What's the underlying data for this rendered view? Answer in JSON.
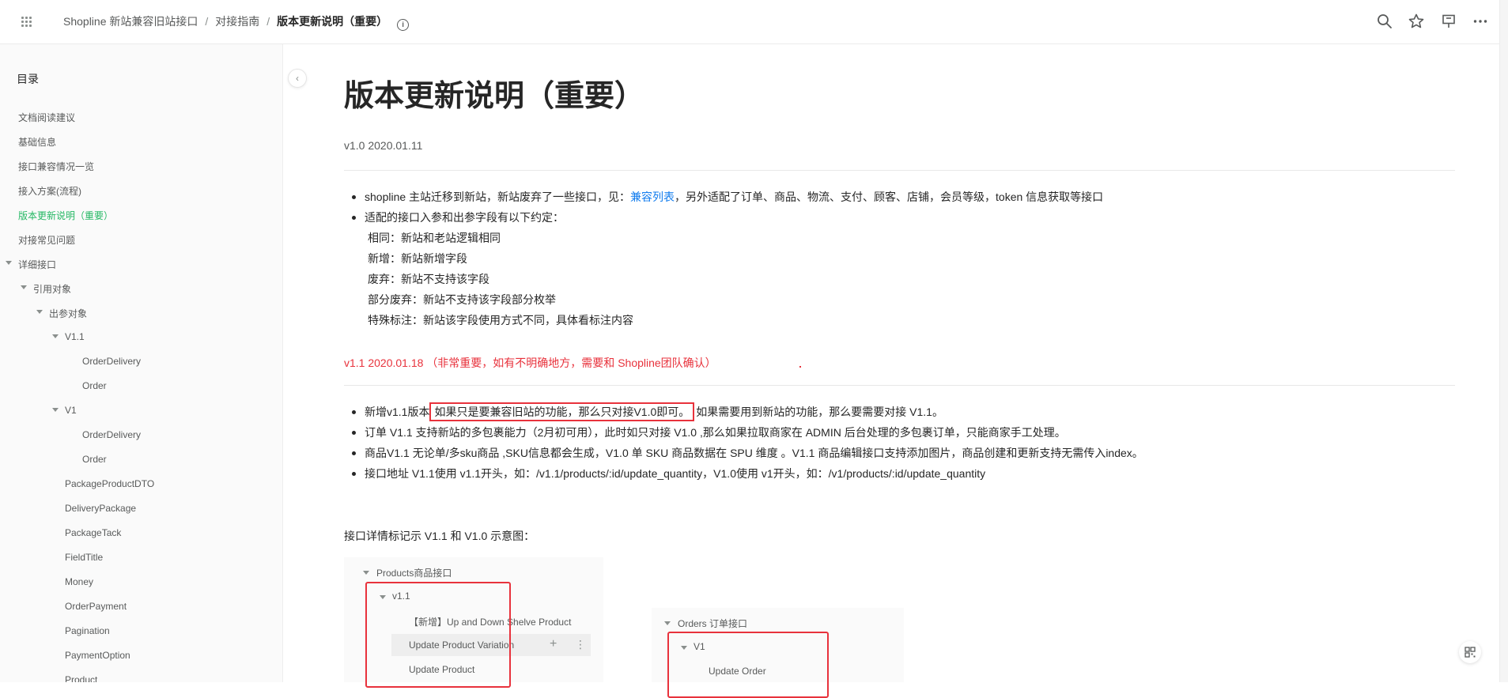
{
  "breadcrumb": {
    "items": [
      "Shopline 新站兼容旧站接口",
      "对接指南",
      "版本更新说明（重要）"
    ]
  },
  "toc": {
    "title": "目录",
    "items": [
      {
        "label": "文档阅读建议",
        "level": 0
      },
      {
        "label": "基础信息",
        "level": 0
      },
      {
        "label": "接口兼容情况一览",
        "level": 0
      },
      {
        "label": "接入方案(流程)",
        "level": 0
      },
      {
        "label": "版本更新说明（重要）",
        "level": 0,
        "active": true
      },
      {
        "label": "对接常见问题",
        "level": 0
      },
      {
        "label": "详细接口",
        "level": 0,
        "expanded": true
      },
      {
        "label": "引用对象",
        "level": 1,
        "expanded": true
      },
      {
        "label": "出参对象",
        "level": 2,
        "expanded": true
      },
      {
        "label": "V1.1",
        "level": 3,
        "expanded": true
      },
      {
        "label": "OrderDelivery",
        "level": 4
      },
      {
        "label": "Order",
        "level": 4
      },
      {
        "label": "V1",
        "level": 3,
        "expanded": true
      },
      {
        "label": "OrderDelivery",
        "level": 4
      },
      {
        "label": "Order",
        "level": 4
      },
      {
        "label": "PackageProductDTO",
        "level": 3
      },
      {
        "label": "DeliveryPackage",
        "level": 3
      },
      {
        "label": "PackageTack",
        "level": 3
      },
      {
        "label": "FieldTitle",
        "level": 3
      },
      {
        "label": "Money",
        "level": 3
      },
      {
        "label": "OrderPayment",
        "level": 3
      },
      {
        "label": "Pagination",
        "level": 3
      },
      {
        "label": "PaymentOption",
        "level": 3
      },
      {
        "label": "Product",
        "level": 3
      }
    ]
  },
  "doc": {
    "title": "版本更新说明（重要）",
    "v10": {
      "heading": "v1.0 2020.01.11",
      "bullet1_pre": "shopline 主站迁移到新站，新站废弃了一些接口，见：",
      "bullet1_link": "兼容列表",
      "bullet1_post": "，另外适配了订单、商品、物流、支付、顾客、店铺，会员等级，token 信息获取等接口",
      "bullet2": "适配的接口入参和出参字段有以下约定：",
      "rules": [
        "相同：新站和老站逻辑相同",
        "新增：新站新增字段",
        "废弃：新站不支持该字段",
        "部分废弃：新站不支持该字段部分枚举",
        "特殊标注：新站该字段使用方式不同，具体看标注内容"
      ]
    },
    "v11": {
      "heading": "v1.1 2020.01.18 （非常重要，如有不明确地方，需要和 Shopline团队确认）",
      "b1_pre": "新增v1.1版本",
      "b1_box": "如果只是要兼容旧站的功能，那么只对接V1.0即可。",
      "b1_post": "如果需要用到新站的功能，那么要需要对接 V1.1。",
      "b2": "订单 V1.1 支持新站的多包裹能力（2月初可用），此时如只对接 V1.0 ,那么如果拉取商家在 ADMIN 后台处理的多包裹订单，只能商家手工处理。",
      "b3": "商品V1.1 无论单/多sku商品 ,SKU信息都会生成，V1.0 单 SKU 商品数据在 SPU 维度 。V1.1 商品编辑接口支持添加图片，商品创建和更新支持无需传入index。",
      "b4": "接口地址 V1.1使用 v1.1开头，如：/v1.1/products/:id/update_quantity，V1.0使用 v1开头，如：/v1/products/:id/update_quantity"
    },
    "figure_caption": "接口详情标记示 V1.1 和 V1.0 示意图：",
    "shot1": {
      "root": "Products商品接口",
      "group": "v1.1",
      "items": [
        "【新增】Up and Down Shelve Product",
        "Update Product Variation",
        "Update Product"
      ]
    },
    "shot2": {
      "root": "Orders 订单接口",
      "group": "V1",
      "items": [
        "Update Order"
      ]
    }
  },
  "colors": {
    "accent_green": "#25b864",
    "link_blue": "#117cee",
    "alert_red": "#e8323c"
  }
}
